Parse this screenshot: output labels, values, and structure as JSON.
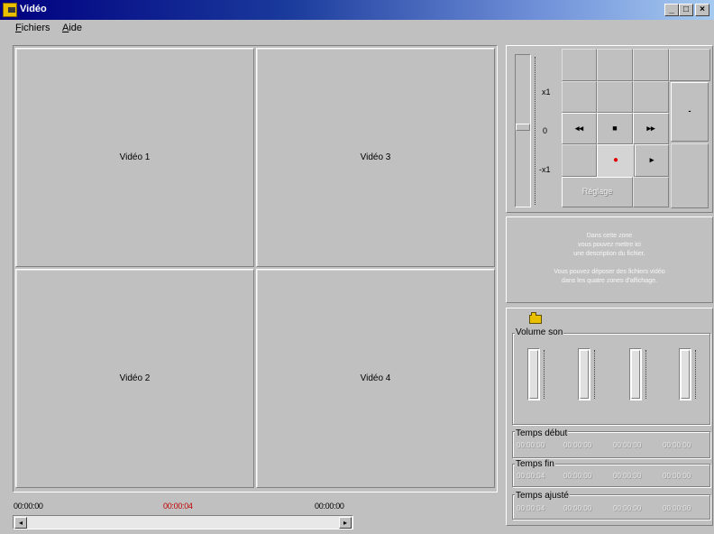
{
  "window": {
    "title": "Vidéo"
  },
  "menu": [
    {
      "label_u": "F",
      "label_rest": "ichiers"
    },
    {
      "label_u": "A",
      "label_rest": "ide"
    }
  ],
  "videos": [
    "Vidéo 1",
    "Vidéo 3",
    "Vidéo 2",
    "Vidéo 4"
  ],
  "timeline": {
    "start": "00:00:00",
    "current": "00:00:04",
    "end": "00:00:00"
  },
  "speed_slider": {
    "labels": [
      "x1",
      "0",
      "-x1"
    ]
  },
  "transport": {
    "rewind": "◂◂",
    "stop": "■",
    "fast_forward": "▸▸",
    "record": "●",
    "play": "▸",
    "small_dash": "-",
    "reglage_label": "Réglage"
  },
  "info_text": [
    "Dans cette zone",
    "vous pouvez mettre ici",
    "une description du fichier.",
    "",
    "Vous pouvez déposer des fichiers vidéo",
    "dans les quatre zones d'affichage."
  ],
  "volume": {
    "title": "Volume son"
  },
  "times": {
    "start": {
      "title": "Temps début",
      "values": [
        "00:00:00",
        "00:00:00",
        "00:00:00",
        "00:00:00"
      ]
    },
    "end": {
      "title": "Temps fin",
      "values": [
        "00:00:04",
        "00:00:00",
        "00:00:00",
        "00:00:00"
      ]
    },
    "adjusted": {
      "title": "Temps ajusté",
      "values": [
        "00:00:04",
        "00:00:00",
        "00:00:00",
        "00:00:00"
      ]
    }
  },
  "colors": {
    "current_time": "#c00000",
    "record_dot": "#e00000"
  }
}
